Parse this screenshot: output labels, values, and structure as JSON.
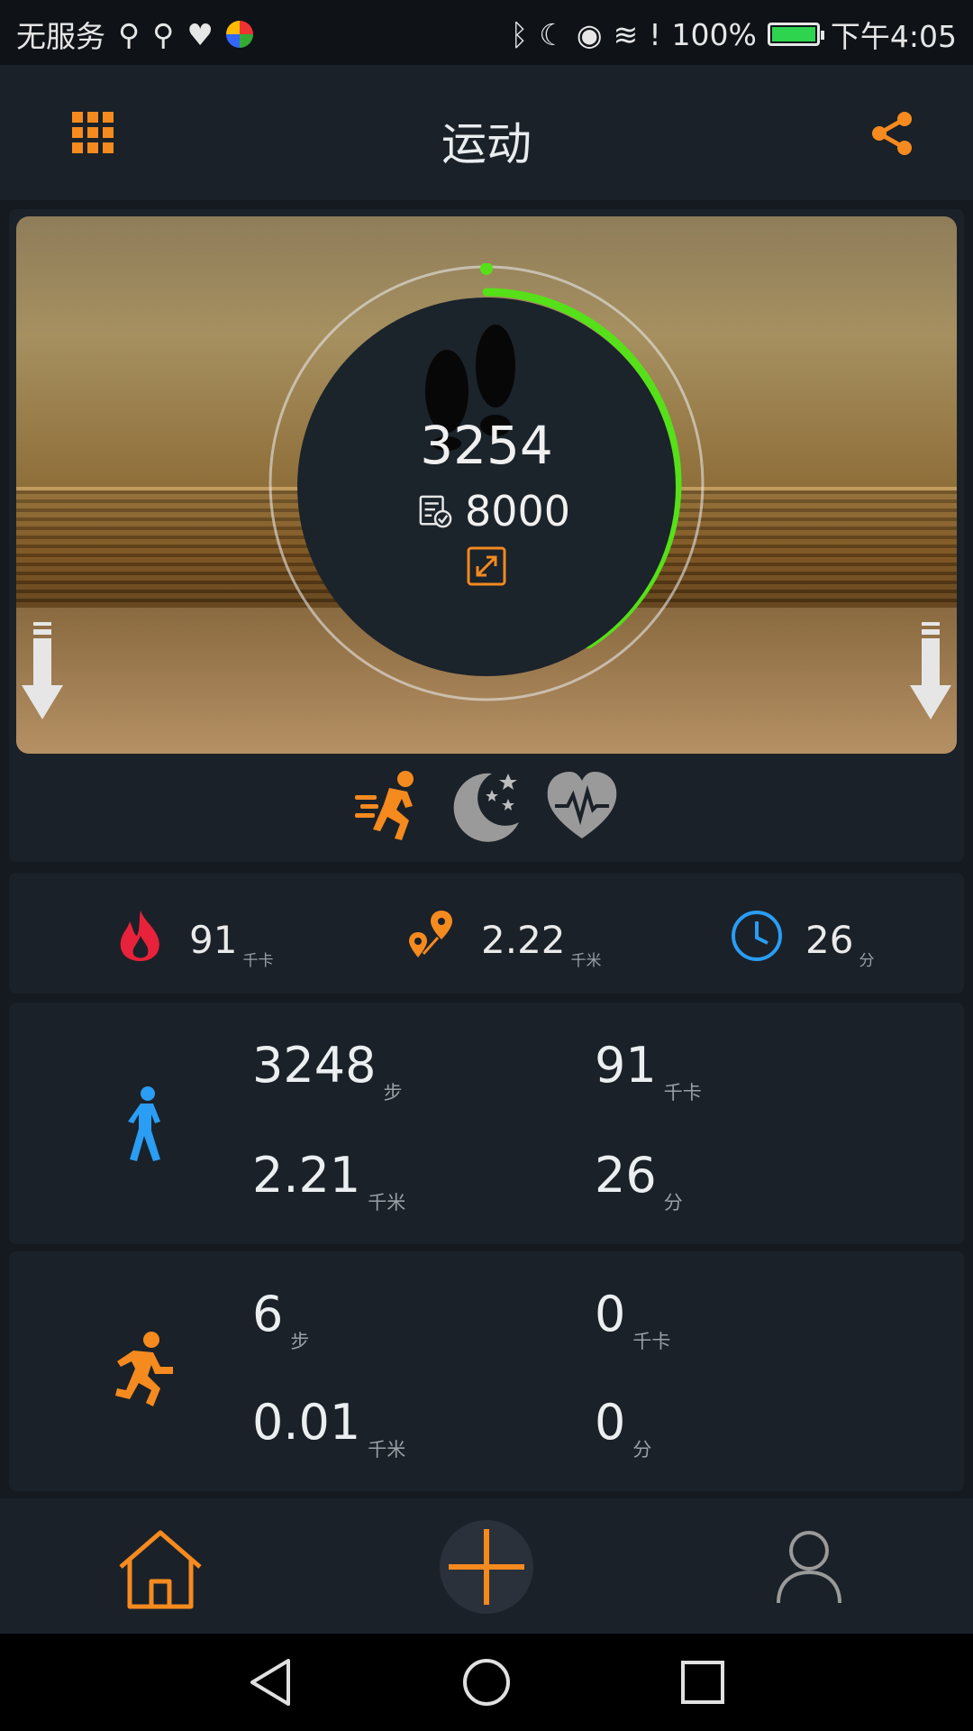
{
  "status_bar": {
    "carrier": "无服务",
    "battery": "100%",
    "time": "下午4:05"
  },
  "header": {
    "title": "运动"
  },
  "hero": {
    "steps": "3254",
    "goal": "8000",
    "progress_fraction": 0.41,
    "progress_color": "#56e019"
  },
  "summary": {
    "calories": {
      "value": "91",
      "unit": "千卡"
    },
    "distance": {
      "value": "2.22",
      "unit": "千米"
    },
    "duration": {
      "value": "26",
      "unit": "分"
    }
  },
  "walk": {
    "steps": {
      "value": "3248",
      "unit": "步"
    },
    "calories": {
      "value": "91",
      "unit": "千卡"
    },
    "distance": {
      "value": "2.21",
      "unit": "千米"
    },
    "duration": {
      "value": "26",
      "unit": "分"
    }
  },
  "run": {
    "steps": {
      "value": "6",
      "unit": "步"
    },
    "calories": {
      "value": "0",
      "unit": "千卡"
    },
    "distance": {
      "value": "0.01",
      "unit": "千米"
    },
    "duration": {
      "value": "0",
      "unit": "分"
    }
  },
  "colors": {
    "accent": "#f58a1f",
    "walk_blue": "#2a9df4",
    "fire_red": "#e8223a",
    "clock_blue": "#2a9df4"
  }
}
